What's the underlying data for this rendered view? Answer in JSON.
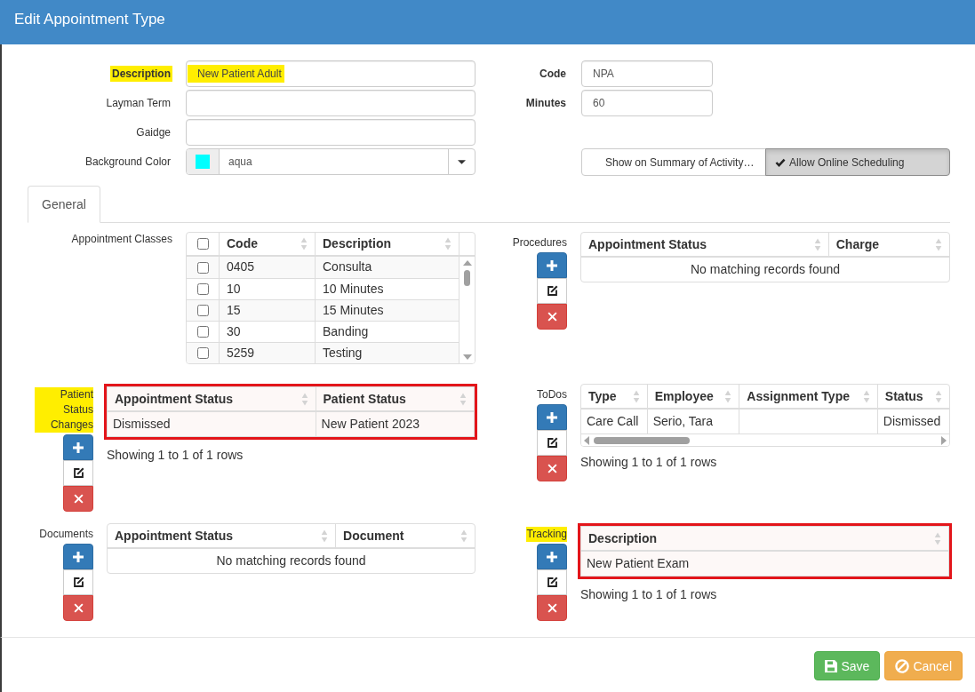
{
  "dialog": {
    "title": "Edit Appointment Type"
  },
  "form": {
    "left_fields": [
      {
        "kind": "text",
        "label": "Description",
        "value": "New Patient Adult",
        "required": true,
        "highlighted": true
      },
      {
        "kind": "text",
        "label": "Layman Term",
        "required": false,
        "highlighted": false
      },
      {
        "kind": "text",
        "label": "Gaidge",
        "required": false,
        "highlighted": false
      },
      {
        "kind": "color",
        "label": "Background Color",
        "value": "aqua",
        "color": "#00ffff",
        "required": false,
        "highlighted": false
      }
    ],
    "right_fields": [
      {
        "kind": "text",
        "label": "Code",
        "value": "NPA",
        "required": true,
        "highlighted": false
      },
      {
        "kind": "text",
        "label": "Minutes",
        "value": "60",
        "required": true,
        "highlighted": false
      }
    ],
    "toggles": [
      {
        "label": "Show on Summary of Activity…",
        "checked": false
      },
      {
        "label": "Allow Online Scheduling",
        "checked": true
      }
    ]
  },
  "tabs": [
    {
      "label": "General",
      "selected": true
    }
  ],
  "sections": [
    {
      "kind": "checklist",
      "label": "Appointment Classes",
      "highlighted": false,
      "outlined": false,
      "scrolls": true,
      "select_all_checked": false,
      "columns": [
        "Code",
        "Description"
      ],
      "rows": [
        {
          "checked": false,
          "cells": [
            "0405",
            "Consulta"
          ]
        },
        {
          "checked": false,
          "cells": [
            "10",
            "10 Minutes"
          ]
        },
        {
          "checked": false,
          "cells": [
            "15",
            "15 Minutes"
          ]
        },
        {
          "checked": false,
          "cells": [
            "30",
            "Banding"
          ]
        },
        {
          "checked": false,
          "cells": [
            "5259",
            "Testing"
          ]
        }
      ]
    },
    {
      "kind": "grid",
      "label": "Procedures",
      "highlighted": false,
      "outlined": false,
      "scrolls": false,
      "columns": [
        "Appointment Status",
        "Charge"
      ],
      "empty_text": "No matching records found"
    },
    {
      "kind": "grid",
      "label": "Patient Status Changes",
      "highlighted": true,
      "outlined": true,
      "scrolls": false,
      "columns": [
        "Appointment Status",
        "Patient Status"
      ],
      "rows": [
        [
          "Dismissed",
          "New Patient 2023"
        ]
      ],
      "footer": "Showing 1 to 1 of 1 rows"
    },
    {
      "kind": "grid",
      "label": "ToDos",
      "highlighted": false,
      "outlined": false,
      "scrolls": true,
      "columns": [
        "Type",
        "Employee",
        "Assignment Type",
        "Status"
      ],
      "rows": [
        [
          "Care Call",
          "Serio, Tara",
          null,
          "Dismissed"
        ]
      ],
      "footer": "Showing 1 to 1 of 1 rows"
    },
    {
      "kind": "grid",
      "label": "Documents",
      "highlighted": false,
      "outlined": false,
      "scrolls": false,
      "columns": [
        "Appointment Status",
        "Document"
      ],
      "empty_text": "No matching records found"
    },
    {
      "kind": "grid",
      "label": "Tracking",
      "highlighted": true,
      "outlined": true,
      "scrolls": false,
      "columns": [
        "Description"
      ],
      "rows": [
        [
          "New Patient Exam"
        ]
      ],
      "footer": "Showing 1 to 1 of 1 rows"
    }
  ],
  "footer_buttons": [
    {
      "kind": "save",
      "label": "Save"
    },
    {
      "kind": "cancel",
      "label": "Cancel"
    }
  ]
}
